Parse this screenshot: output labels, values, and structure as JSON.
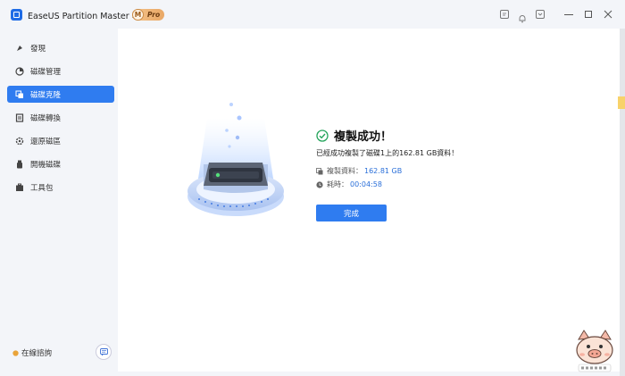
{
  "app": {
    "title": "EaseUS Partition Master 專業版",
    "badge_letter": "M",
    "badge_text": "Pro"
  },
  "titlebar_icons": [
    "feedback-icon",
    "notification-bell-icon",
    "menu-icon"
  ],
  "window_controls": [
    "minimize-icon",
    "maximize-icon",
    "close-icon"
  ],
  "sidebar": {
    "items": [
      {
        "label": "發現",
        "icon": "discover-icon",
        "active": false
      },
      {
        "label": "磁碟管理",
        "icon": "disk-manager-icon",
        "active": false
      },
      {
        "label": "磁碟克隆",
        "icon": "disk-clone-icon",
        "active": true
      },
      {
        "label": "磁碟轉換",
        "icon": "disk-convert-icon",
        "active": false
      },
      {
        "label": "還原磁區",
        "icon": "partition-recovery-icon",
        "active": false
      },
      {
        "label": "開機磁碟",
        "icon": "bootable-media-icon",
        "active": false
      },
      {
        "label": "工具包",
        "icon": "toolkit-icon",
        "active": false
      }
    ],
    "footer_help": "在線諮詢",
    "footer_chat_icon": "chat-icon"
  },
  "result": {
    "title": "複製成功！",
    "message": "已經成功複製了磁碟1上的162.81 GB資料！",
    "copied_label": "複製資料：",
    "copied_value": "162.81 GB",
    "time_label": "耗時：",
    "time_value": "00:04:58",
    "done_label": "完成"
  },
  "colors": {
    "accent": "#2f7cf0",
    "success": "#22a35a",
    "value_blue": "#2a6fd9"
  }
}
